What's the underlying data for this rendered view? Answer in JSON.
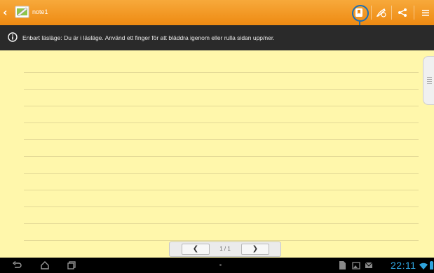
{
  "app": {
    "note_title": "note1"
  },
  "toolbar": {
    "back_icon": "chevron-left-icon",
    "bookmark_icon": "bookmark-icon",
    "edit_icon": "pen-icon",
    "share_icon": "share-icon",
    "menu_icon": "menu-icon",
    "accent_color": "#ee8a12",
    "highlight_color": "#1c6fb4"
  },
  "infobar": {
    "text": "Enbart läsläge: Du är i läsläge. Använd ett finger för att bläddra igenom eller rulla sidan upp/ner."
  },
  "pager": {
    "prev_label": "❮",
    "next_label": "❯",
    "page_indicator": "1 / 1"
  },
  "status": {
    "time": "22:11",
    "clock_color": "#2fa3dc"
  }
}
